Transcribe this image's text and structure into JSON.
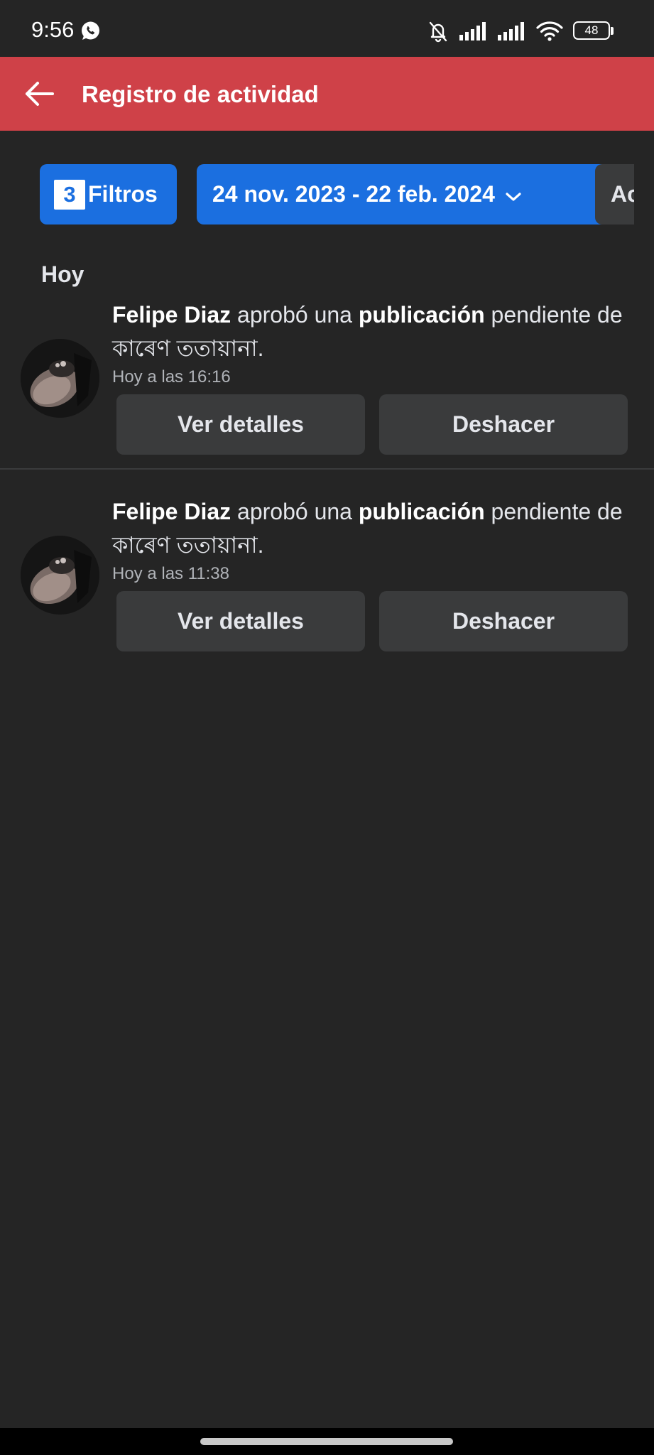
{
  "status_bar": {
    "time": "9:56",
    "battery": "48",
    "icons": [
      "whatsapp-icon",
      "bell-off-icon",
      "signal-icon",
      "signal-icon",
      "wifi-icon",
      "battery-icon"
    ]
  },
  "header": {
    "title": "Registro de actividad",
    "back_icon": "arrow-left-icon",
    "background": "#cf4148"
  },
  "filters": {
    "count": "3",
    "filters_label": "Filtros",
    "date_range": "24 nov. 2023 - 22 feb. 2024",
    "more_label": "Ac",
    "accent": "#1b6fe0"
  },
  "section": {
    "title": "Hoy"
  },
  "activities": [
    {
      "actor": "Felipe Diaz",
      "verb": "aprobó una",
      "object": "publicación",
      "rest": "pendiente de কাৰেণ ততায়ানা.",
      "time": "Hoy a las 16:16",
      "details_label": "Ver detalles",
      "undo_label": "Deshacer"
    },
    {
      "actor": "Felipe Diaz",
      "verb": "aprobó una",
      "object": "publicación",
      "rest": "pendiente de কাৰেণ ততায়ানা.",
      "time": "Hoy a las 11:38",
      "details_label": "Ver detalles",
      "undo_label": "Deshacer"
    }
  ]
}
